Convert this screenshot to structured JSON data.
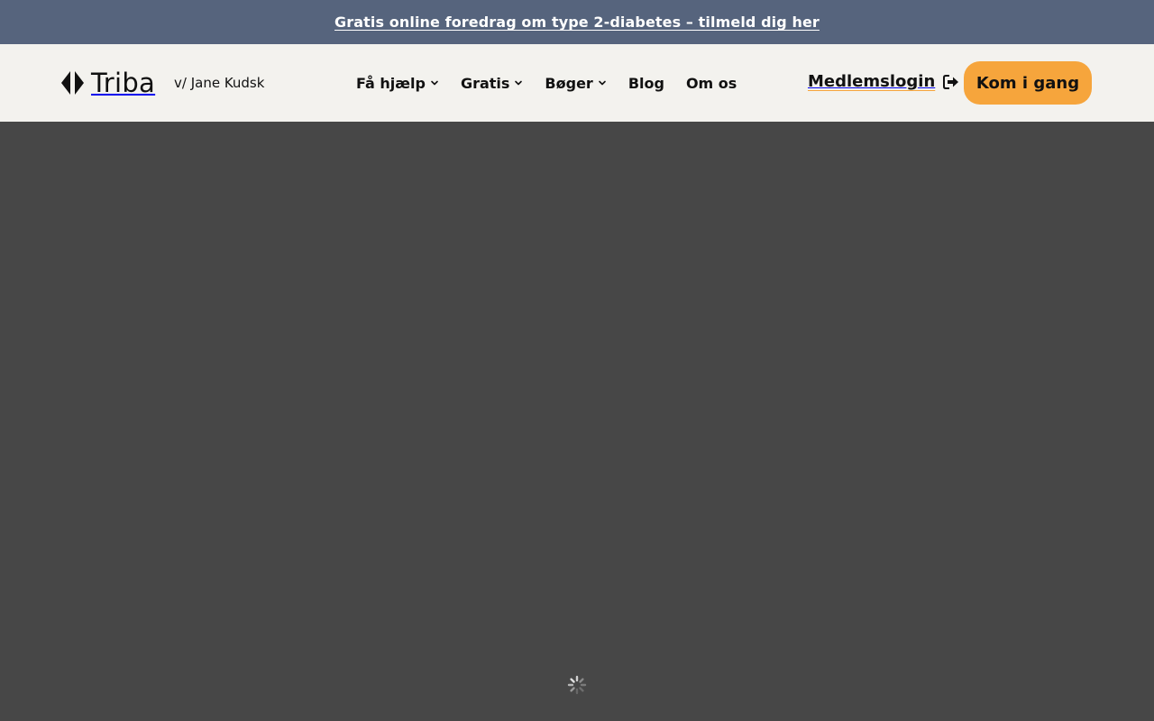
{
  "announcement": {
    "text": "Gratis online foredrag om type 2-diabetes – tilmeld dig her"
  },
  "header": {
    "logo_text": "Triba",
    "byline": "v/ Jane Kudsk",
    "nav": [
      {
        "label": "Få hjælp",
        "has_dropdown": true
      },
      {
        "label": "Gratis",
        "has_dropdown": true
      },
      {
        "label": "Bøger",
        "has_dropdown": true
      },
      {
        "label": "Blog",
        "has_dropdown": false
      },
      {
        "label": "Om os",
        "has_dropdown": false
      }
    ],
    "login_label": "Medlemslogin",
    "login_icon": "sign-in-icon",
    "cta_label": "Kom i gang"
  },
  "content": {
    "state": "loading",
    "loader_icon": "spinner-icon"
  },
  "colors": {
    "announcement_bg": "#56647d",
    "header_bg": "#f3f2ee",
    "accent": "#f6a53c",
    "content_bg": "#474747"
  }
}
